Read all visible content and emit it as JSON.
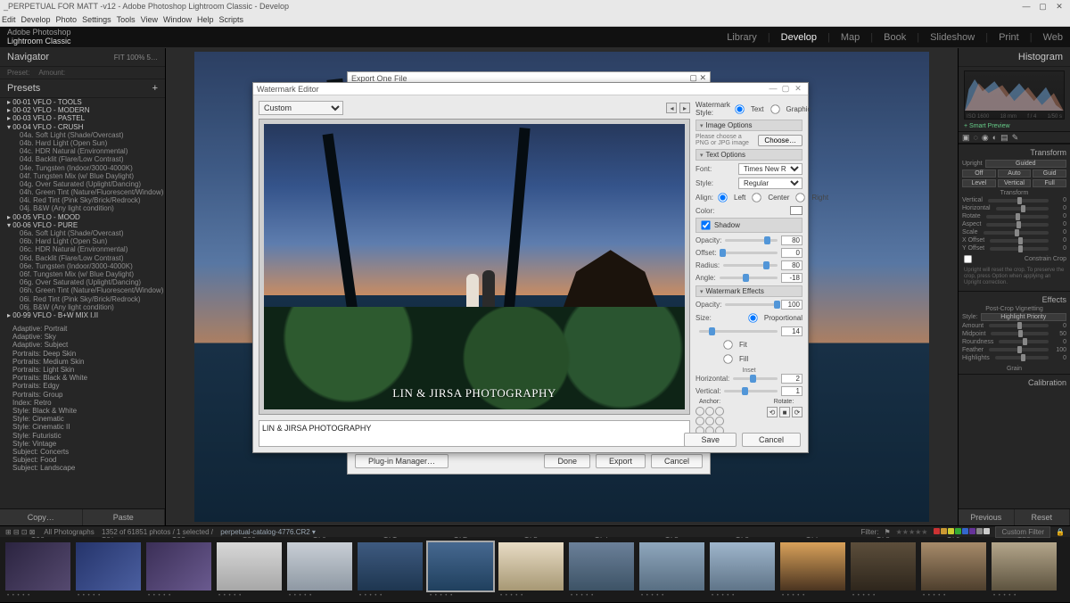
{
  "window": {
    "title": "_PERPETUAL FOR MATT -v12 - Adobe Photoshop Lightroom Classic - Develop",
    "menus": [
      "Edit",
      "Develop",
      "Photo",
      "Settings",
      "Tools",
      "View",
      "Window",
      "Help",
      "Scripts"
    ],
    "brand_line1": "Adobe Photoshop",
    "brand_line2": "Lightroom Classic",
    "modules": [
      "Library",
      "Develop",
      "Map",
      "Book",
      "Slideshow",
      "Print",
      "Web"
    ],
    "active_module": "Develop"
  },
  "left": {
    "navigator": "Navigator",
    "nav_opts": [
      "FIT",
      "100%",
      "5…"
    ],
    "presets_label": "Presets",
    "copy": "Copy…",
    "paste": "Paste",
    "groups": [
      "00-01 VFLO - TOOLS",
      "00-02 VFLO - MODERN",
      "00-03 VFLO - PASTEL",
      "00-04 VFLO - CRUSH",
      "00-05 VFLO - MOOD",
      "00-06 VFLO - PURE",
      "00-99 VFLO - B+W MIX I.II"
    ],
    "crush_items": [
      "04a. Soft Light (Shade/Overcast)",
      "04b. Hard Light (Open Sun)",
      "04c. HDR Natural (Environmental)",
      "04d. Backlit (Flare/Low Contrast)",
      "04e. Tungsten (Indoor/3000-4000K)",
      "04f. Tungsten Mix (w/ Blue Daylight)",
      "04g. Over Saturated (Uplight/Dancing)",
      "04h. Green Tint (Nature/Fluorescent/Window)",
      "04i. Red Tint (Pink Sky/Brick/Redrock)",
      "04j. B&W (Any light condition)"
    ],
    "pure_items": [
      "06a. Soft Light (Shade/Overcast)",
      "06b. Hard Light (Open Sun)",
      "06c. HDR Natural (Environmental)",
      "06d. Backlit (Flare/Low Contrast)",
      "06e. Tungsten (Indoor/3000-4000K)",
      "06f. Tungsten Mix (w/ Blue Daylight)",
      "06g. Over Saturated (Uplight/Dancing)",
      "06h. Green Tint (Nature/Fluorescent/Window)",
      "06i. Red Tint (Pink Sky/Brick/Redrock)",
      "06j. B&W (Any light condition)"
    ],
    "user_presets": [
      "Adaptive: Portrait",
      "Adaptive: Sky",
      "Adaptive: Subject",
      "Portraits: Deep Skin",
      "Portraits: Medium Skin",
      "Portraits: Light Skin",
      "Portraits: Black & White",
      "Portraits: Edgy",
      "Portraits: Group",
      "Index: Retro",
      "Style: Black & White",
      "Style: Cinematic",
      "Style: Cinematic II",
      "Style: Futuristic",
      "Style: Vintage",
      "Subject: Concerts",
      "Subject: Food",
      "Subject: Landscape"
    ]
  },
  "right": {
    "histogram": "Histogram",
    "hist_ticks": [
      "ISO 1600",
      "18 mm",
      "f / 4",
      "1/50 s"
    ],
    "smart_preview": "+ Smart Preview",
    "transform": "Transform",
    "upright": "Upright",
    "upright_mode": "Guided",
    "transform_hdr": "Transform",
    "trows": [
      "Vertical",
      "Horizontal",
      "Rotate",
      "Aspect",
      "Scale",
      "X Offset",
      "Y Offset"
    ],
    "constrain": "Constrain Crop",
    "tip": "Upright will reset the crop. To preserve the crop, press Option when applying an Upright correction.",
    "effects": "Effects",
    "pcv": "Post-Crop Vignetting",
    "pcv_style_label": "Style:",
    "pcv_style": "Highlight Priority",
    "erows": [
      {
        "l": "Amount",
        "v": "0"
      },
      {
        "l": "Midpoint",
        "v": "50"
      },
      {
        "l": "Roundness",
        "v": "0"
      },
      {
        "l": "Feather",
        "v": "100"
      },
      {
        "l": "Highlights",
        "v": "0"
      }
    ],
    "grain": "Grain",
    "calibration": "Calibration",
    "previous": "Previous",
    "reset": "Reset"
  },
  "export": {
    "title": "Export One File",
    "plugin": "Plug-in Manager…",
    "done": "Done",
    "export": "Export",
    "cancel": "Cancel"
  },
  "wm": {
    "title": "Watermark Editor",
    "preset_label": "Custom",
    "style_label": "Watermark Style:",
    "style_text": "Text",
    "style_graphic": "Graphic",
    "image_options": "Image Options",
    "image_hint": "Please choose a PNG or JPG image",
    "choose": "Choose…",
    "text_options": "Text Options",
    "font_label": "Font:",
    "font_value": "Times New Roman",
    "style_sel_label": "Style:",
    "style_sel_value": "Regular",
    "align_label": "Align:",
    "align_left": "Left",
    "align_center": "Center",
    "align_right": "Right",
    "color_label": "Color:",
    "shadow": "Shadow",
    "opacity_label": "Opacity:",
    "offset_label": "Offset:",
    "radius_label": "Radius:",
    "angle_label": "Angle:",
    "shadow_opacity": "80",
    "shadow_offset": "0",
    "shadow_radius": "80",
    "shadow_angle": "-18",
    "effects": "Watermark Effects",
    "eff_opacity": "100",
    "size_label": "Size:",
    "size_proportional": "Proportional",
    "size_value": "14",
    "size_fit": "Fit",
    "size_fill": "Fill",
    "inset_label": "Inset",
    "inset_h_label": "Horizontal:",
    "inset_h": "2",
    "inset_v_label": "Vertical:",
    "inset_v": "1",
    "anchor_label": "Anchor:",
    "rotate_label": "Rotate:",
    "save": "Save",
    "cancel": "Cancel",
    "wm_text": "LIN & JIRSA PHOTOGRAPHY",
    "wm_input": "LIN & JIRSA PHOTOGRAPHY"
  },
  "filmstrip": {
    "all": "All Photographs",
    "count": "1352 of 61851 photos / 1 selected /",
    "filename": "perpetual-catalog-4776.CR2 ▾",
    "filter_label": "Filter:",
    "custom_filter": "Custom Filter",
    "swatch_colors": [
      "#c33",
      "#c93",
      "#cc3",
      "#3a3",
      "#36c",
      "#639",
      "#888",
      "#ccc"
    ],
    "thumbs": [
      {
        "n": "166",
        "bg": "linear-gradient(135deg,#2b2440,#55496f)"
      },
      {
        "n": "167",
        "bg": "linear-gradient(135deg,#25346b,#4b5fa0)"
      },
      {
        "n": "168",
        "bg": "linear-gradient(135deg,#3b2f57,#6a5a8f)"
      },
      {
        "n": "169",
        "bg": "linear-gradient(180deg,#d8d8d8,#a7a7a7)"
      },
      {
        "n": "170",
        "bg": "linear-gradient(180deg,#c9cfd6,#8e98a3)"
      },
      {
        "n": "171",
        "bg": "linear-gradient(180deg,#3e5a80,#1e3650)"
      },
      {
        "n": "172",
        "bg": "linear-gradient(180deg,#466890,#20405e)"
      },
      {
        "n": "173",
        "bg": "linear-gradient(180deg,#e8dcc5,#a79874)"
      },
      {
        "n": "174",
        "bg": "linear-gradient(180deg,#6b8099,#3d5366)"
      },
      {
        "n": "175",
        "bg": "linear-gradient(180deg,#8fa7bd,#586e82)"
      },
      {
        "n": "176",
        "bg": "linear-gradient(180deg,#9fb6cc,#5f7488)"
      },
      {
        "n": "177",
        "bg": "linear-gradient(180deg,#d9a15a,#4a3420)"
      },
      {
        "n": "178",
        "bg": "linear-gradient(180deg,#5c4e3b,#2e261c)"
      },
      {
        "n": "179",
        "bg": "linear-gradient(180deg,#a78b6a,#4e3f2d)"
      },
      {
        "n": "180",
        "bg": "linear-gradient(180deg,#b4a68b,#5d533f)"
      }
    ],
    "selected": "172"
  }
}
